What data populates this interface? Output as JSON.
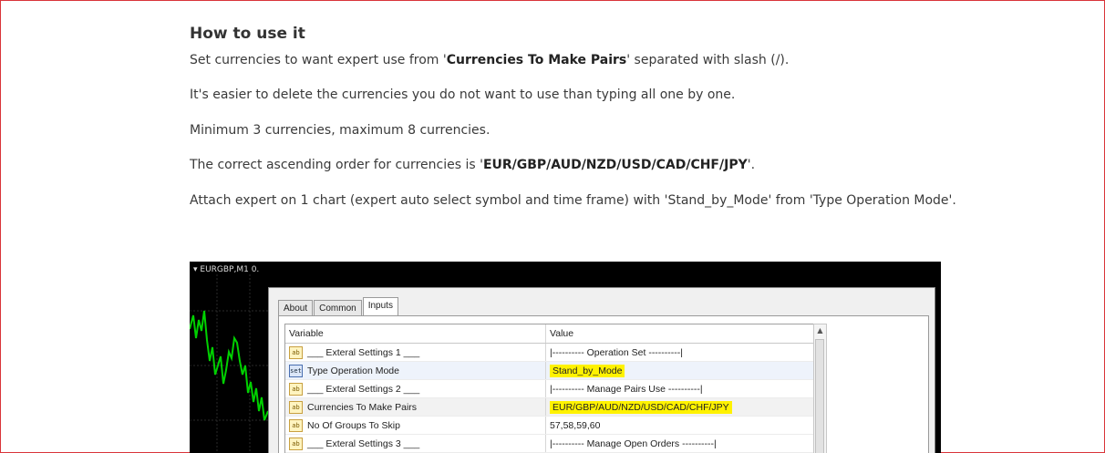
{
  "article": {
    "heading": "How to use it",
    "p1_a": "Set currencies to want expert use from '",
    "p1_b": "Currencies To Make Pairs",
    "p1_c": "' separated with slash (/).",
    "p2": "It's easier to delete the currencies you do not want to use than typing all one by one.",
    "p3": "Minimum 3 currencies, maximum 8 currencies.",
    "p4_a": "The correct ascending order for currencies is '",
    "p4_b": "EUR/GBP/AUD/NZD/USD/CAD/CHF/JPY",
    "p4_c": "'.",
    "p5": "Attach expert on 1 chart (expert auto select symbol and time frame) with 'Stand_by_Mode' from 'Type Operation Mode'."
  },
  "screenshot": {
    "chart_label": "▾ EURGBP,M1  0.",
    "tabs": [
      "About",
      "Common",
      "Inputs"
    ],
    "header": {
      "variable": "Variable",
      "value": "Value"
    },
    "rows": [
      {
        "icon": "ab",
        "variable": "___ Exteral Settings 1 ___",
        "value": "|---------- Operation Set ----------|"
      },
      {
        "icon": "set",
        "variable": "Type Operation Mode",
        "value": "Stand_by_Mode"
      },
      {
        "icon": "ab",
        "variable": "___ Exteral Settings 2 ___",
        "value": "|---------- Manage Pairs Use ----------|"
      },
      {
        "icon": "ab",
        "variable": "Currencies To Make Pairs",
        "value": "EUR/GBP/AUD/NZD/USD/CAD/CHF/JPY"
      },
      {
        "icon": "ab",
        "variable": "No Of Groups To Skip",
        "value": "57,58,59,60"
      },
      {
        "icon": "ab",
        "variable": "___ Exteral Settings 3 ___",
        "value": "|---------- Manage Open Orders ----------|"
      }
    ],
    "colors": {
      "highlight": "#fff200",
      "candle_up": "#00d000",
      "chart_bg": "#000000"
    }
  }
}
